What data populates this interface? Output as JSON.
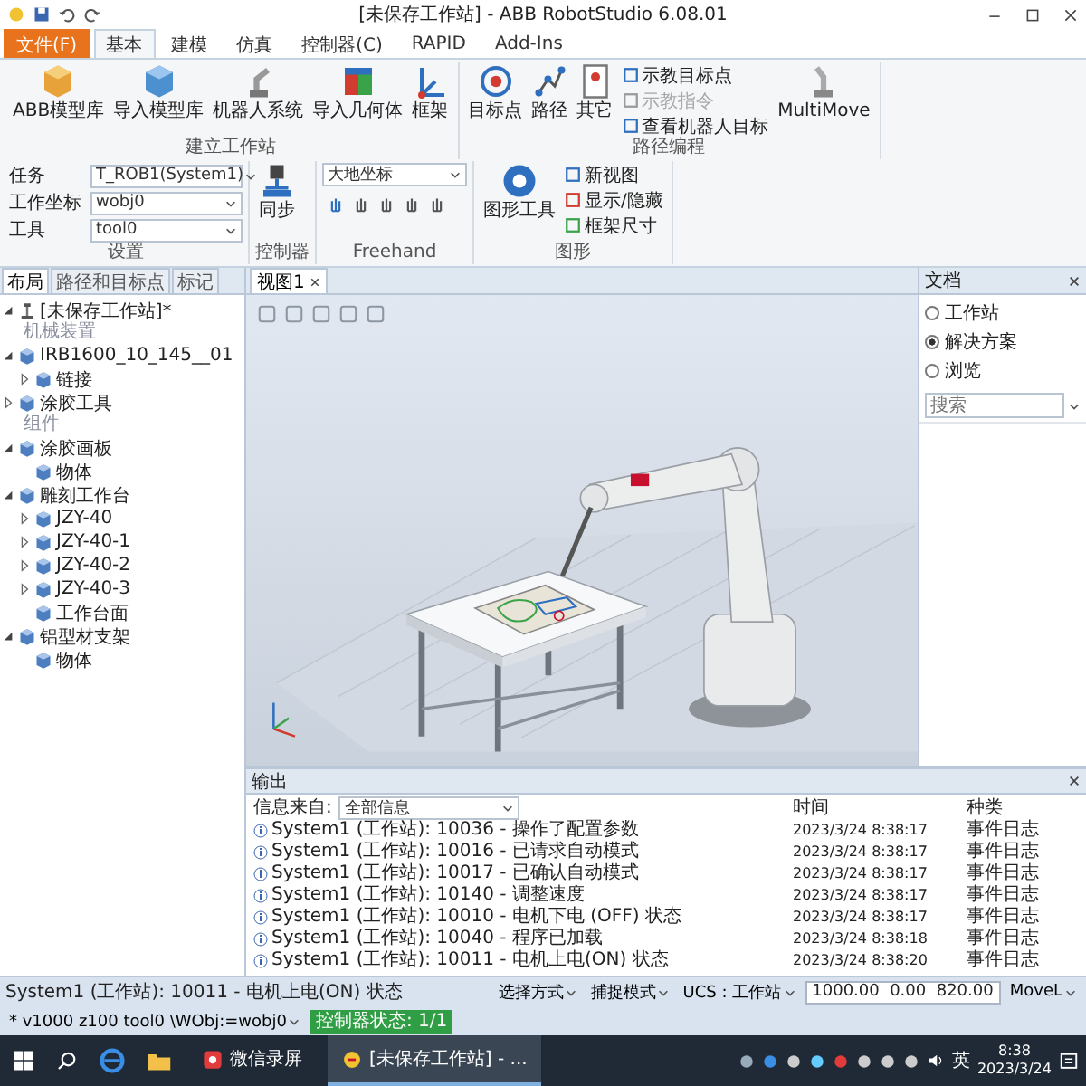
{
  "window": {
    "title": "[未保存工作站] - ABB RobotStudio 6.08.01"
  },
  "ribbon": {
    "tabs": [
      {
        "label": "文件(F)",
        "kind": "file",
        "selected": false
      },
      {
        "label": "基本",
        "kind": "tab",
        "selected": true
      },
      {
        "label": "建模",
        "kind": "tab",
        "selected": false
      },
      {
        "label": "仿真",
        "kind": "tab",
        "selected": false
      },
      {
        "label": "控制器(C)",
        "kind": "tab",
        "selected": false
      },
      {
        "label": "RAPID",
        "kind": "tab",
        "selected": false
      },
      {
        "label": "Add-Ins",
        "kind": "tab",
        "selected": false
      }
    ],
    "groups": [
      {
        "title": "建立工作站",
        "items": [
          {
            "kind": "large",
            "label": "ABB模型库"
          },
          {
            "kind": "large",
            "label": "导入模型库"
          },
          {
            "kind": "large",
            "label": "机器人系统"
          },
          {
            "kind": "large",
            "label": "导入几何体"
          },
          {
            "kind": "large",
            "label": "框架"
          }
        ]
      },
      {
        "title": "路径编程",
        "items": [
          {
            "kind": "large",
            "label": "目标点"
          },
          {
            "kind": "large",
            "label": "路径"
          },
          {
            "kind": "large",
            "label": "其它"
          },
          {
            "kind": "small",
            "label": "示教目标点",
            "disabled": false
          },
          {
            "kind": "small",
            "label": "示教指令",
            "disabled": true
          },
          {
            "kind": "small",
            "label": "查看机器人目标",
            "disabled": false
          },
          {
            "kind": "large",
            "label": "MultiMove"
          }
        ]
      },
      {
        "title": "设置",
        "items": [
          {
            "kind": "field",
            "label": "任务",
            "value": "T_ROB1(System1)"
          },
          {
            "kind": "field",
            "label": "工作坐标",
            "value": "wobj0"
          },
          {
            "kind": "field",
            "label": "工具",
            "value": "tool0"
          }
        ]
      },
      {
        "title": "控制器",
        "items": [
          {
            "kind": "large",
            "label": "同步"
          }
        ]
      },
      {
        "title": "Freehand",
        "items": [
          {
            "kind": "combo",
            "value": "大地坐标"
          }
        ]
      },
      {
        "title": "图形",
        "items": [
          {
            "kind": "large",
            "label": "图形工具"
          },
          {
            "kind": "small",
            "label": "新视图",
            "disabled": false
          },
          {
            "kind": "small",
            "label": "显示/隐藏",
            "disabled": false
          },
          {
            "kind": "small",
            "label": "框架尺寸",
            "disabled": false
          }
        ]
      }
    ]
  },
  "left_panel": {
    "tabs": [
      {
        "label": "布局",
        "selected": true
      },
      {
        "label": "路径和目标点",
        "selected": false
      },
      {
        "label": "标记",
        "selected": false
      }
    ],
    "tree": [
      {
        "label": "[未保存工作站]*",
        "expanded": true,
        "children": [
          {
            "kind": "header",
            "label": "机械装置"
          },
          {
            "label": "IRB1600_10_145__01",
            "expanded": true,
            "children": [
              {
                "label": "链接",
                "expanded": false
              }
            ]
          },
          {
            "label": "涂胶工具",
            "expanded": false
          },
          {
            "kind": "header",
            "label": "组件"
          },
          {
            "label": "涂胶画板",
            "expanded": true,
            "children": [
              {
                "label": "物体"
              }
            ]
          },
          {
            "label": "雕刻工作台",
            "expanded": true,
            "children": [
              {
                "label": "JZY-40",
                "expanded": false
              },
              {
                "label": "JZY-40-1",
                "expanded": false
              },
              {
                "label": "JZY-40-2",
                "expanded": false
              },
              {
                "label": "JZY-40-3",
                "expanded": false
              },
              {
                "label": "工作台面"
              }
            ]
          },
          {
            "label": "铝型材支架",
            "expanded": true,
            "children": [
              {
                "label": "物体"
              }
            ]
          }
        ]
      }
    ]
  },
  "viewport": {
    "tab": "视图1"
  },
  "document_panel": {
    "title": "文档",
    "options": [
      {
        "label": "工作站",
        "selected": false
      },
      {
        "label": "解决方案",
        "selected": true
      },
      {
        "label": "浏览",
        "selected": false
      }
    ],
    "search": {
      "placeholder": "搜索"
    }
  },
  "output": {
    "title": "输出",
    "filter_label": "信息来自:",
    "filter_value": "全部信息",
    "columns": [
      "时间",
      "种类"
    ],
    "rows": [
      {
        "message": "System1 (工作站): 10036 - 操作了配置参数",
        "time": "2023/3/24 8:38:17",
        "category": "事件日志"
      },
      {
        "message": "System1 (工作站): 10016 - 已请求自动模式",
        "time": "2023/3/24 8:38:17",
        "category": "事件日志"
      },
      {
        "message": "System1 (工作站): 10017 - 已确认自动模式",
        "time": "2023/3/24 8:38:17",
        "category": "事件日志"
      },
      {
        "message": "System1 (工作站): 10140 - 调整速度",
        "time": "2023/3/24 8:38:17",
        "category": "事件日志"
      },
      {
        "message": "System1 (工作站): 10010 - 电机下电 (OFF) 状态",
        "time": "2023/3/24 8:38:17",
        "category": "事件日志"
      },
      {
        "message": "System1 (工作站): 10040 - 程序已加载",
        "time": "2023/3/24 8:38:18",
        "category": "事件日志"
      },
      {
        "message": "System1 (工作站): 10011 - 电机上电(ON) 状态",
        "time": "2023/3/24 8:38:20",
        "category": "事件日志"
      }
    ]
  },
  "status_bar": [
    {
      "kind": "text",
      "text": "System1 (工作站): 10011 - 电机上电(ON) 状态"
    },
    {
      "kind": "dropdown",
      "text": "选择方式"
    },
    {
      "kind": "dropdown",
      "text": "捕捉模式"
    },
    {
      "kind": "dropdown",
      "text": "UCS : 工作站"
    },
    {
      "kind": "field",
      "text": "1000.00  0.00  820.00"
    },
    {
      "kind": "dropdown",
      "text": "MoveL"
    },
    {
      "kind": "dropdown",
      "text": "* v1000 z100 tool0 \\WObj:=wobj0"
    },
    {
      "kind": "status",
      "text": "控制器状态: 1/1"
    }
  ],
  "taskbar": {
    "apps": [
      {
        "label": "微信录屏",
        "selected": false
      },
      {
        "label": "[未保存工作站] - ...",
        "selected": true
      }
    ],
    "input_method": "英",
    "time": "8:38",
    "date": "2023/3/24"
  }
}
